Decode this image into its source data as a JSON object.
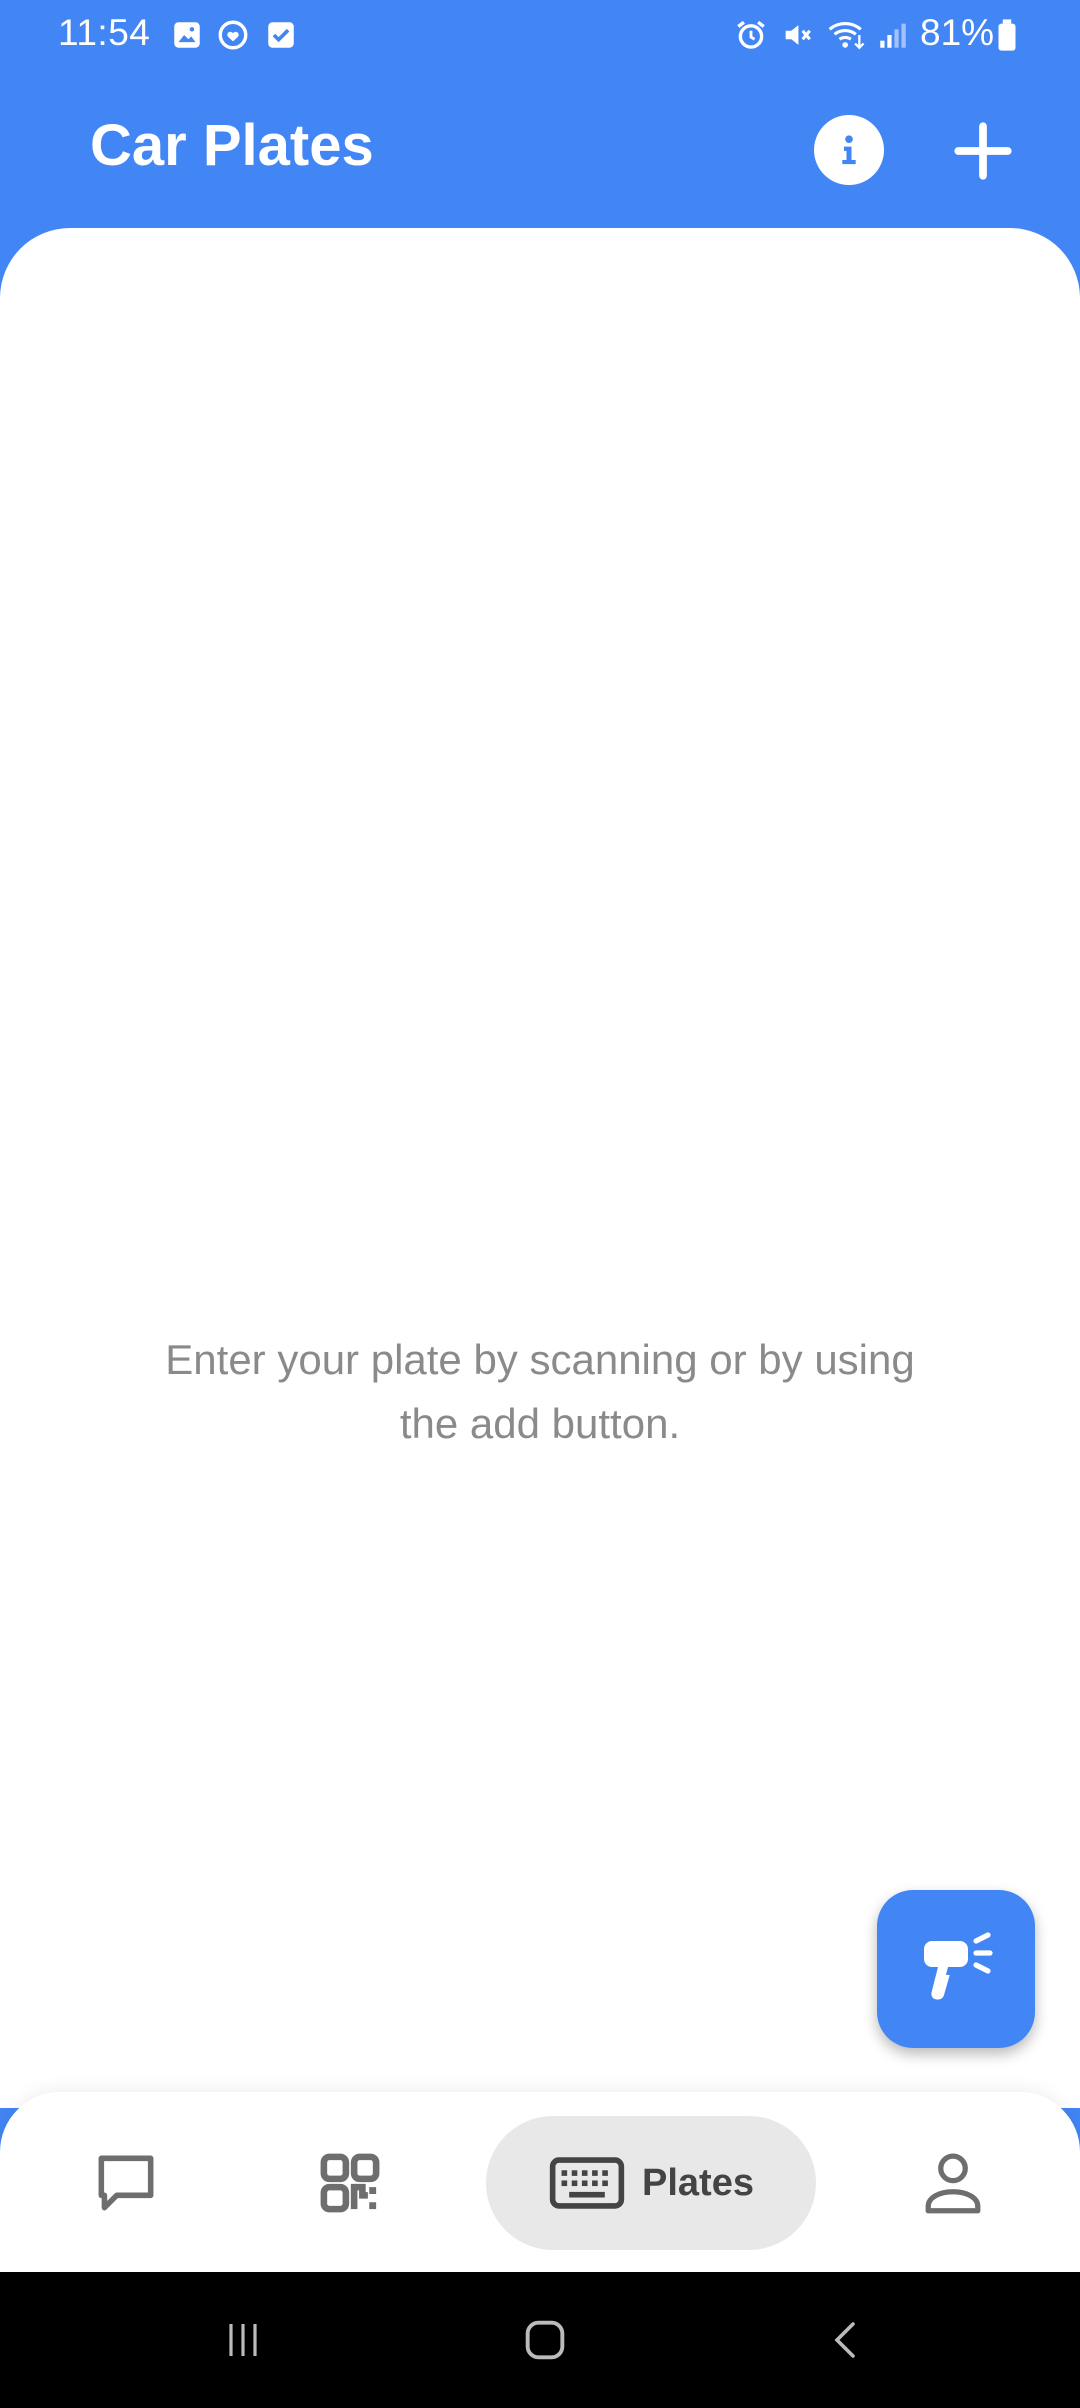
{
  "status_bar": {
    "time": "11:54",
    "battery_percent": "81%",
    "left_icons": [
      "gallery-icon",
      "sync-heart-icon",
      "checkbox-icon"
    ],
    "right_icons": [
      "alarm-icon",
      "mute-icon",
      "wifi-icon",
      "signal-icon",
      "battery-icon"
    ]
  },
  "app_bar": {
    "title": "Car Plates",
    "actions": [
      "info-icon",
      "plus-icon"
    ]
  },
  "main": {
    "empty_message": "Enter your plate  by scanning or  by using\nthe add button."
  },
  "fab": {
    "icon": "barcode-scanner-icon"
  },
  "bottom_nav": {
    "items": [
      {
        "icon": "chat-icon",
        "label": ""
      },
      {
        "icon": "qr-code-icon",
        "label": ""
      },
      {
        "icon": "keyboard-icon",
        "label": "Plates",
        "selected": true
      },
      {
        "icon": "person-icon",
        "label": ""
      }
    ]
  },
  "colors": {
    "primary": "#4285F4",
    "surface": "#FFFFFF",
    "selected_pill": "#E8E8E8",
    "muted_text": "#8A8A8A"
  }
}
